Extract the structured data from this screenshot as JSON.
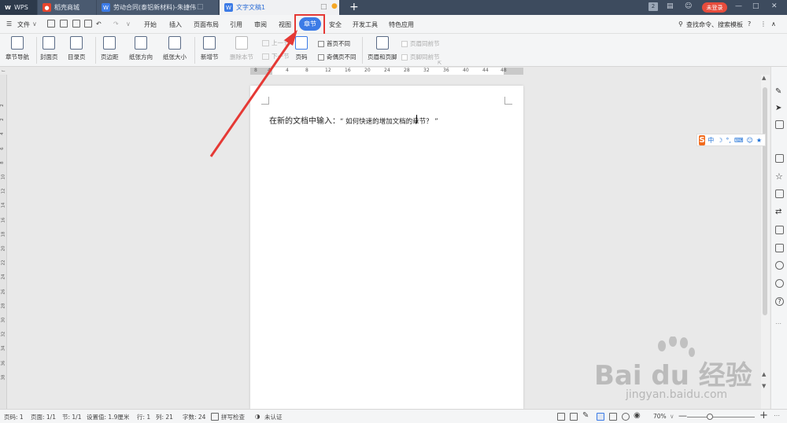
{
  "tabs": {
    "wps": "WPS",
    "t1": "稻壳商城",
    "t2": "劳动合同(泰铝新材料)-朱捷伟",
    "t3": "文字文稿1",
    "login": "未登录",
    "badge": "2"
  },
  "menu": {
    "file": "文件",
    "items": [
      "开始",
      "插入",
      "页面布局",
      "引用",
      "审阅",
      "视图",
      "章节",
      "安全",
      "开发工具",
      "特色应用"
    ],
    "search": "查找命令、搜索模板"
  },
  "ribbon": {
    "nav": "章节导航",
    "cover": "封面页",
    "toc": "目录页",
    "margin": "页边距",
    "orientation": "纸张方向",
    "size": "纸张大小",
    "new_section": "新增节",
    "delete_section": "删除本节",
    "prev_section": "上一节",
    "next_section": "下一节",
    "page_number": "页码",
    "first_diff": "首页不同",
    "odd_even_diff": "奇偶页不同",
    "header_footer": "页眉和页脚",
    "same_as_prev_header": "页眉同前节",
    "same_as_prev_footer": "页脚同前节"
  },
  "ruler": {
    "h_marks": [
      "8",
      "4",
      "4",
      "8",
      "12",
      "16",
      "20",
      "24",
      "28",
      "32",
      "36",
      "40",
      "44",
      "48"
    ],
    "v_marks": [
      "2",
      "2",
      "4",
      "6",
      "8",
      "10",
      "12",
      "14",
      "16",
      "18",
      "20",
      "22",
      "24",
      "26",
      "28",
      "30",
      "32",
      "34",
      "36",
      "38"
    ]
  },
  "document": {
    "text_before": "在新的文档中输入：",
    "text_quote": "“ 如何快速的增加文档的章节？ ”"
  },
  "ime": {
    "chars": [
      "中",
      "☽",
      "°,",
      "⌨",
      "☺",
      "★"
    ]
  },
  "status": {
    "page": "页码: 1",
    "pages": "页面: 1/1",
    "section": "节: 1/1",
    "setting": "设置值: 1.9厘米",
    "row": "行: 1",
    "col": "列: 21",
    "words": "字数: 24",
    "spellcheck": "拼写检查",
    "auth": "未认证",
    "zoom": "70%"
  },
  "watermark": {
    "brand": "Bai du 经验",
    "url": "jingyan.baidu.com"
  },
  "colors": {
    "accent": "#3c7be6",
    "highlight": "#e53935",
    "tabbar": "#3d4b5e"
  }
}
